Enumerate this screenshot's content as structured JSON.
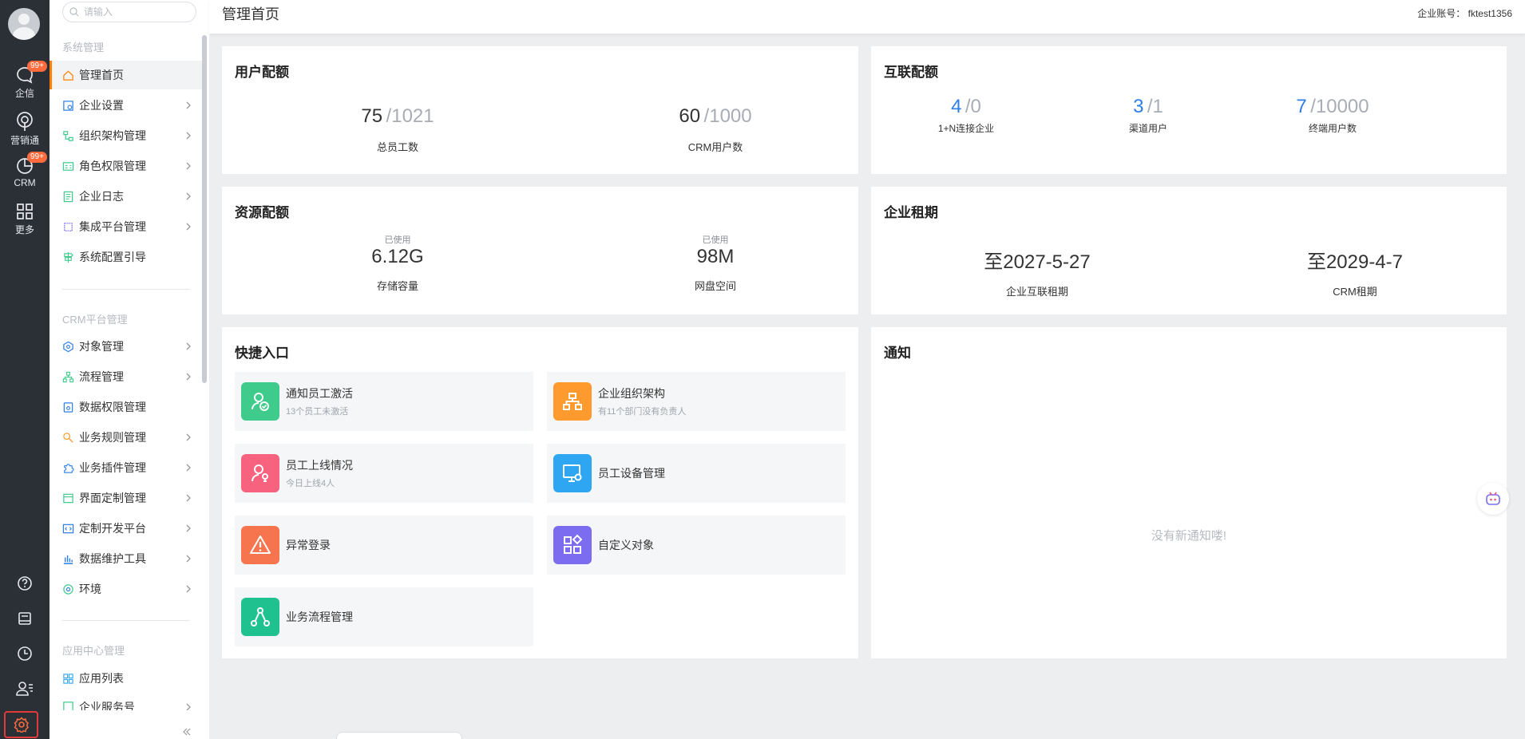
{
  "search": {
    "placeholder": "请输入"
  },
  "rail": {
    "items": [
      {
        "label": "企信",
        "badge": "99+"
      },
      {
        "label": "营销通"
      },
      {
        "label": "CRM",
        "badge": "99+"
      },
      {
        "label": "更多"
      }
    ]
  },
  "sidebar": {
    "sections": [
      "系统管理",
      "CRM平台管理",
      "应用中心管理"
    ],
    "system_items": [
      {
        "label": "管理首页",
        "icon": "home-icon"
      },
      {
        "label": "企业设置",
        "icon": "building-icon"
      },
      {
        "label": "组织架构管理",
        "icon": "org-icon"
      },
      {
        "label": "角色权限管理",
        "icon": "id-card-icon"
      },
      {
        "label": "企业日志",
        "icon": "log-icon"
      },
      {
        "label": "集成平台管理",
        "icon": "chip-icon"
      },
      {
        "label": "系统配置引导",
        "icon": "guide-icon"
      }
    ],
    "crm_items": [
      {
        "label": "对象管理",
        "icon": "cube-icon"
      },
      {
        "label": "流程管理",
        "icon": "flow-icon"
      },
      {
        "label": "数据权限管理",
        "icon": "data-lock-icon"
      },
      {
        "label": "业务规则管理",
        "icon": "rule-icon"
      },
      {
        "label": "业务插件管理",
        "icon": "plugin-icon"
      },
      {
        "label": "界面定制管理",
        "icon": "layout-icon"
      },
      {
        "label": "定制开发平台",
        "icon": "code-icon"
      },
      {
        "label": "数据维护工具",
        "icon": "bar-chart-icon"
      },
      {
        "label": "环境",
        "icon": "env-icon"
      }
    ],
    "app_items": [
      {
        "label": "应用列表",
        "icon": "grid-icon"
      },
      {
        "label": "企业服务号",
        "icon": "service-icon"
      }
    ]
  },
  "header": {
    "title": "管理首页",
    "account_label": "企业账号：",
    "account_value": "fktest1356"
  },
  "user_quota": {
    "title": "用户配额",
    "stats": [
      {
        "used": "75",
        "total": "/1021",
        "label": "总员工数"
      },
      {
        "used": "60",
        "total": "/1000",
        "label": "CRM用户数"
      }
    ]
  },
  "interconnect_quota": {
    "title": "互联配额",
    "stats": [
      {
        "used": "4",
        "total": "/0",
        "label": "1+N连接企业"
      },
      {
        "used": "3",
        "total": "/1",
        "label": "渠道用户"
      },
      {
        "used": "7",
        "total": "/10000",
        "label": "终端用户数"
      }
    ]
  },
  "resource_quota": {
    "title": "资源配额",
    "used_label": "已使用",
    "stats": [
      {
        "value": "6.12G",
        "label": "存储容量"
      },
      {
        "value": "98M",
        "label": "网盘空间"
      }
    ]
  },
  "lease": {
    "title": "企业租期",
    "stats": [
      {
        "value": "至2027-5-27",
        "label": "企业互联租期"
      },
      {
        "value": "至2029-4-7",
        "label": "CRM租期"
      }
    ]
  },
  "quick_entry": {
    "title": "快捷入口",
    "items": [
      {
        "title": "通知员工激活",
        "sub": "13个员工未激活",
        "color": "#3ecb8b",
        "icon": "user-check-icon"
      },
      {
        "title": "企业组织架构",
        "sub": "有11个部门没有负责人",
        "color": "#ff9a2e",
        "icon": "org-chart-icon"
      },
      {
        "title": "员工上线情况",
        "sub": "今日上线4人",
        "color": "#f7637e",
        "icon": "user-online-icon"
      },
      {
        "title": "员工设备管理",
        "sub": "",
        "color": "#2fa6f2",
        "icon": "device-settings-icon"
      },
      {
        "title": "异常登录",
        "sub": "",
        "color": "#f7754e",
        "icon": "warning-icon"
      },
      {
        "title": "自定义对象",
        "sub": "",
        "color": "#7b6cf0",
        "icon": "shapes-icon"
      },
      {
        "title": "业务流程管理",
        "sub": "",
        "color": "#1fc28f",
        "icon": "workflow-icon"
      }
    ]
  },
  "notice": {
    "title": "通知",
    "empty": "没有新通知喽!"
  },
  "colors": {
    "accent": "#ff8000",
    "rail_bg": "#2b2f36",
    "link_blue": "#2d7ee8"
  }
}
